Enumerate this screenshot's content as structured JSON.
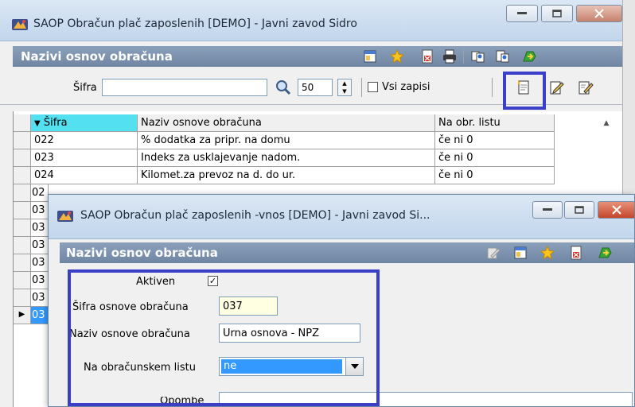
{
  "main_window": {
    "title": "SAOP Obračun plač zaposlenih [DEMO] - Javni zavod Sidro",
    "panel_title": "Nazivi osnov obračuna",
    "search": {
      "label": "Šifra",
      "value": ""
    },
    "page_size": "50",
    "all_records_label": "Vsi zapisi",
    "grid": {
      "columns": [
        "Šifra",
        "Naziv osnove obračuna",
        "Na obr. listu"
      ],
      "rows": [
        [
          "022",
          "% dodatka za pripr. na domu",
          "če ni 0"
        ],
        [
          "023",
          "Indeks za usklajevanje nadom.",
          "če ni 0"
        ],
        [
          "024",
          "Kilomet.za prevoz na d. do ur.",
          "če ni 0"
        ]
      ],
      "hidden_row_fragments": [
        "02",
        "03",
        "03",
        "03",
        "03",
        "03",
        "03",
        "03"
      ]
    }
  },
  "dialog": {
    "title": "SAOP Obračun plač zaposlenih -vnos [DEMO] - Javni zavod Si...",
    "panel_title": "Nazivi osnov obračuna",
    "fields": {
      "active_label": "Aktiven",
      "active_mark": "✓",
      "code_label": "Šifra osnove obračuna",
      "code_value": "037",
      "name_label": "Naziv osnove obračuna",
      "name_value": "Urna osnova - NPZ",
      "on_sheet_label": "Na obračunskem listu",
      "on_sheet_value": "ne",
      "notes_label": "Opombe"
    }
  },
  "colors": {
    "highlight": "#3b3fc7",
    "sorted_header": "#53e0f0",
    "header_bar": "#7a90ad",
    "selection": "#3399ff"
  }
}
